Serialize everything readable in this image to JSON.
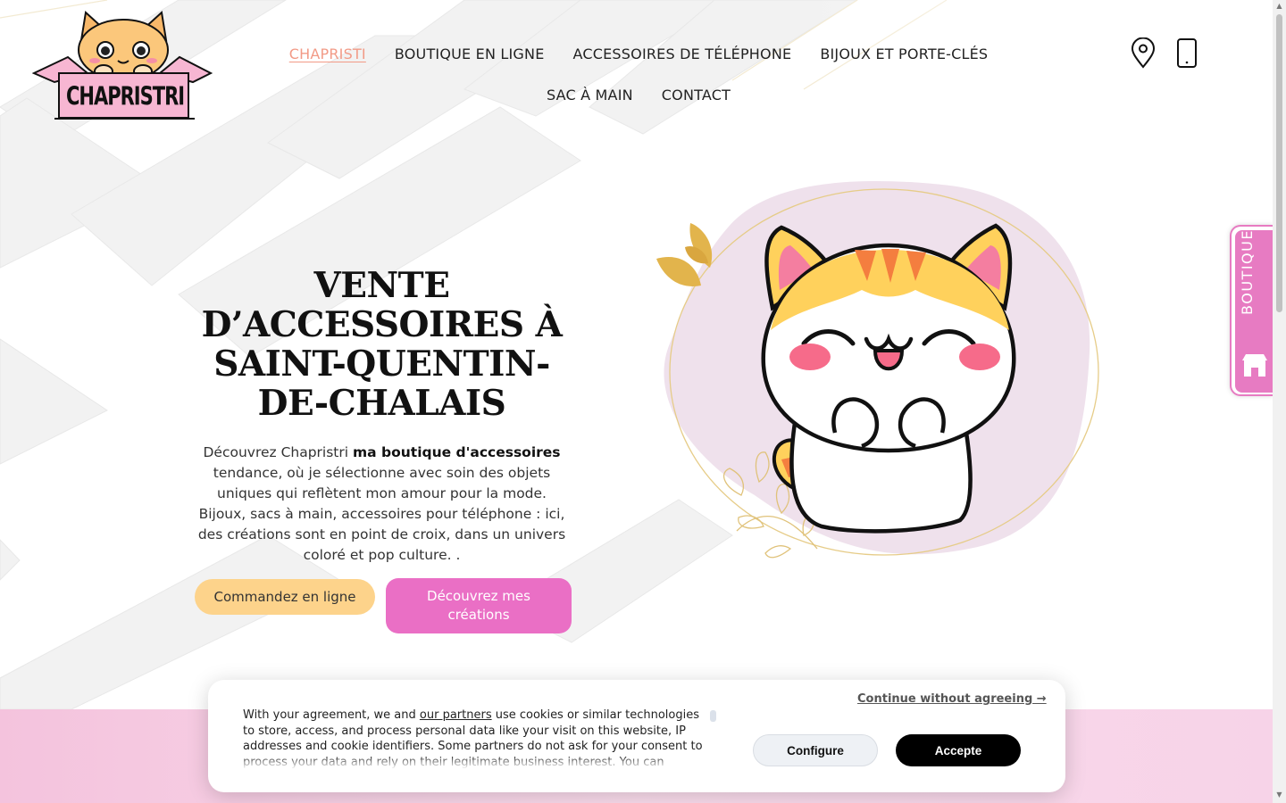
{
  "site": {
    "name": "CHAPRISTRI"
  },
  "nav": {
    "items": [
      {
        "label": "CHAPRISTI",
        "active": true
      },
      {
        "label": "BOUTIQUE EN LIGNE"
      },
      {
        "label": "ACCESSOIRES DE TÉLÉPHONE"
      },
      {
        "label": "BIJOUX ET PORTE-CLÉS"
      },
      {
        "label": "SAC À MAIN"
      },
      {
        "label": "CONTACT"
      }
    ]
  },
  "header_icons": [
    "location-pin-icon",
    "smartphone-icon"
  ],
  "hero": {
    "title": "VENTE D’ACCESSOIRES À SAINT-QUENTIN-DE-CHALAIS",
    "text_before": "Découvrez Chapristri ",
    "text_bold": "ma boutique d'accessoires",
    "text_after": " tendance, où je sélectionne avec soin des objets uniques qui reflètent mon amour pour la mode. Bijoux, sacs à main, accessoires pour téléphone : ici, des créations sont en point de croix, dans un univers coloré et pop culture. .",
    "btn_order": "Commandez en ligne",
    "btn_discover": "Découvrez mes créations"
  },
  "side_tab": {
    "label": "BOUTIQUE",
    "icon": "shop-icon"
  },
  "cookie": {
    "text_start": "With your agreement, we and ",
    "partners_link": "our partners",
    "text_end": " use cookies or similar technologies to store, access, and process personal data like your visit on this website, IP addresses and cookie identifiers. Some partners do not ask for your consent to process your data and rely on their legitimate business interest. You can",
    "continue": "Continue without agreeing →",
    "configure": "Configure",
    "accept": "Accepte"
  },
  "colors": {
    "accent_pink": "#ea6fc5",
    "accent_yellow": "#fdd38b",
    "active_nav": "#f29a86"
  }
}
